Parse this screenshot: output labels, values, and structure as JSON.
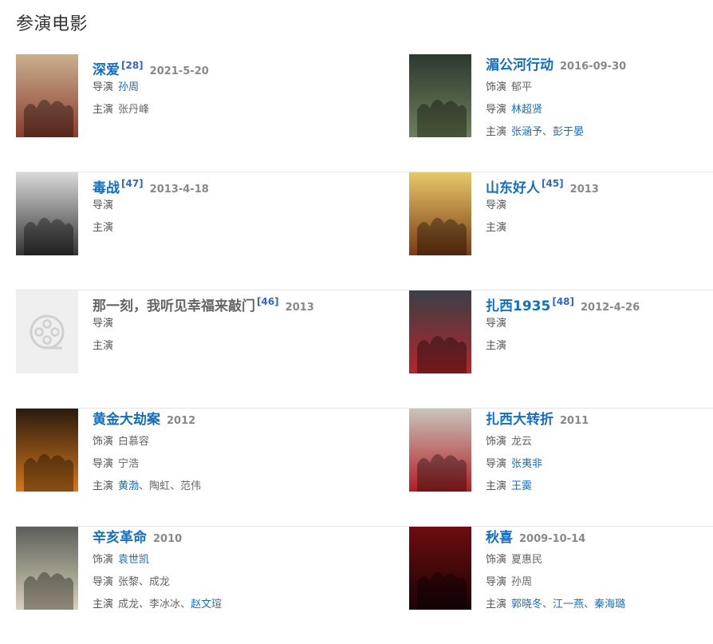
{
  "section": {
    "title": "参演电影"
  },
  "labels": {
    "role": "饰演",
    "director": "导演",
    "starring": "主演",
    "sep": "、"
  },
  "films": [
    {
      "title": "深爱",
      "ref": "[28]",
      "date": "2021-5-20",
      "director": [
        {
          "name": "孙周",
          "link": true
        }
      ],
      "starring": [
        {
          "name": "张丹峰",
          "link": false
        }
      ],
      "poster": {
        "bg": "#c9b08f",
        "accent": "#8a3b2a",
        "text": "深爱"
      }
    },
    {
      "title": "湄公河行动",
      "ref": "",
      "date": "2016-09-30",
      "role": [
        {
          "name": "郁平",
          "link": false
        }
      ],
      "director": [
        {
          "name": "林超贤",
          "link": true
        }
      ],
      "starring": [
        {
          "name": "张涵予",
          "link": true
        },
        {
          "name": "彭于晏",
          "link": true
        }
      ],
      "poster": {
        "bg": "#2b3a30",
        "accent": "#6f7f5a",
        "text": "湄公河行动"
      }
    },
    {
      "title": "毒战",
      "ref": "[47]",
      "date": "2013-4-18",
      "director": [],
      "starring": [],
      "poster": {
        "bg": "#d9d9d9",
        "accent": "#333333",
        "text": "毒战"
      }
    },
    {
      "title": "山东好人",
      "ref": "[45]",
      "date": "2013",
      "director": [],
      "starring": [],
      "poster": {
        "bg": "#e8c86a",
        "accent": "#7a3a14",
        "text": "山东好人"
      }
    },
    {
      "title": "那一刻，我听见幸福来敲门",
      "ref": "[46]",
      "date": "2013",
      "director": [],
      "starring": [],
      "poster": {
        "placeholder": true
      }
    },
    {
      "title": "扎西1935",
      "ref": "[48]",
      "date": "2012-4-26",
      "director": [],
      "starring": [],
      "poster": {
        "bg": "#3a3f48",
        "accent": "#b3262a",
        "text": "扎西1935"
      }
    },
    {
      "title": "黄金大劫案",
      "ref": "",
      "date": "2012",
      "role": [
        {
          "name": "白慕容",
          "link": false
        }
      ],
      "director": [
        {
          "name": "宁浩",
          "link": false
        }
      ],
      "starring": [
        {
          "name": "黄渤",
          "link": true
        },
        {
          "name": "陶虹",
          "link": false
        },
        {
          "name": "范伟",
          "link": false
        }
      ],
      "poster": {
        "bg": "#2a1a0e",
        "accent": "#d4781c",
        "text": "黄金大劫案"
      }
    },
    {
      "title": "扎西大转折",
      "ref": "",
      "date": "2011",
      "role": [
        {
          "name": "龙云",
          "link": false
        }
      ],
      "director": [
        {
          "name": "张夷非",
          "link": true
        }
      ],
      "starring": [
        {
          "name": "王霙",
          "link": true
        }
      ],
      "poster": {
        "bg": "#c9c4bc",
        "accent": "#b11f24",
        "text": "1935"
      }
    },
    {
      "title": "辛亥革命",
      "ref": "",
      "date": "2010",
      "role": [
        {
          "name": "袁世凯",
          "link": true
        }
      ],
      "director": [
        {
          "name": "张黎",
          "link": false
        },
        {
          "name": "成龙",
          "link": false
        }
      ],
      "starring": [
        {
          "name": "成龙",
          "link": false
        },
        {
          "name": "李冰冰",
          "link": false
        },
        {
          "name": "赵文瑄",
          "link": true
        }
      ],
      "poster": {
        "bg": "#5d5f59",
        "accent": "#d9d0b8",
        "text": "辛亥革命"
      }
    },
    {
      "title": "秋喜",
      "ref": "",
      "date": "2009-10-14",
      "role": [
        {
          "name": "夏惠民",
          "link": false
        }
      ],
      "director": [
        {
          "name": "孙周",
          "link": false
        }
      ],
      "starring": [
        {
          "name": "郭晓冬",
          "link": true
        },
        {
          "name": "江一燕",
          "link": true
        },
        {
          "name": "秦海璐",
          "link": true
        }
      ],
      "poster": {
        "bg": "#6e0c10",
        "accent": "#1b0406",
        "text": "秋喜"
      }
    }
  ]
}
